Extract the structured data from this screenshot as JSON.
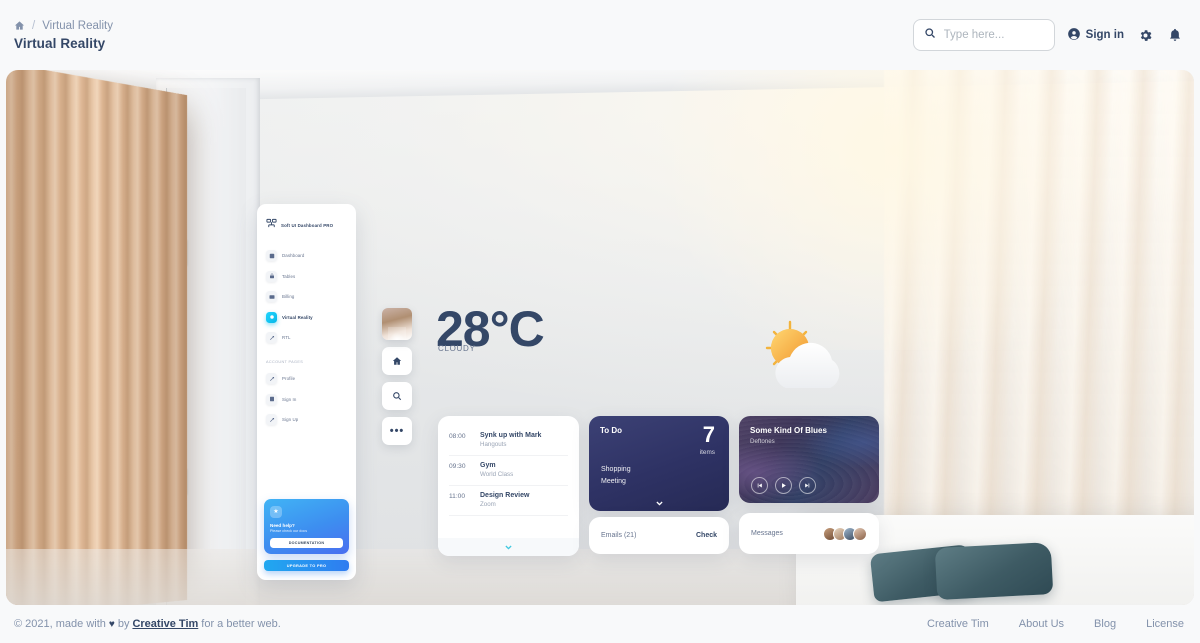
{
  "header": {
    "breadcrumb": {
      "home_icon": "home-icon",
      "separator": "/",
      "current": "Virtual Reality"
    },
    "page_title": "Virtual Reality",
    "search": {
      "placeholder": "Type here...",
      "value": "",
      "icon": "search-icon"
    },
    "sign_in": {
      "label": "Sign in",
      "icon": "account-circle-icon"
    },
    "settings_icon": "gear-icon",
    "notifications_icon": "bell-icon"
  },
  "vr_sidebar": {
    "brand": "Soft UI Dashboard PRO",
    "brand_icon": "soft-ui-logo-icon",
    "items": [
      {
        "label": "Dashboard",
        "icon": "dashboard-icon",
        "active": false
      },
      {
        "label": "Tables",
        "icon": "tables-icon",
        "active": false
      },
      {
        "label": "Billing",
        "icon": "billing-icon",
        "active": false
      },
      {
        "label": "Virtual Reality",
        "icon": "virtual-reality-icon",
        "active": true
      },
      {
        "label": "RTL",
        "icon": "rtl-icon",
        "active": false
      }
    ],
    "section_label": "ACCOUNT PAGES",
    "account_items": [
      {
        "label": "Profile",
        "icon": "profile-icon"
      },
      {
        "label": "Sign In",
        "icon": "sign-in-icon"
      },
      {
        "label": "Sign Up",
        "icon": "sign-up-icon"
      }
    ],
    "help_card": {
      "star_icon": "star-icon",
      "title": "Need help?",
      "subtitle": "Please check our docs",
      "documentation_label": "DOCUMENTATION"
    },
    "upgrade_label": "UPGRADE TO PRO"
  },
  "rail": {
    "avatar": "user-avatar",
    "home_icon": "home-icon",
    "search_icon": "search-icon",
    "more_icon": "more-horizontal-icon"
  },
  "weather": {
    "temperature": "28°C",
    "condition": "CLOUDY",
    "illustration": "sun-behind-cloud-icon"
  },
  "schedule": {
    "rows": [
      {
        "time": "08:00",
        "title": "Synk up with Mark",
        "subtitle": "Hangouts"
      },
      {
        "time": "09:30",
        "title": "Gym",
        "subtitle": "World Class"
      },
      {
        "time": "11:00",
        "title": "Design Review",
        "subtitle": "Zoom"
      }
    ],
    "expand_icon": "chevron-down-icon"
  },
  "todo": {
    "title": "To Do",
    "count": "7",
    "count_label": "items",
    "items": [
      "Shopping",
      "Meeting"
    ],
    "expand_icon": "chevron-down-icon"
  },
  "music": {
    "track": "Some Kind Of Blues",
    "artist": "Deftones",
    "controls": [
      {
        "name": "previous-track-button",
        "icon": "skip-previous-icon"
      },
      {
        "name": "play-button",
        "icon": "play-icon"
      },
      {
        "name": "next-track-button",
        "icon": "skip-next-icon"
      }
    ]
  },
  "emails": {
    "label": "Emails (21)",
    "action": "Check"
  },
  "messages": {
    "label": "Messages",
    "avatar_count": 4
  },
  "footer": {
    "copyright_prefix": "© 2021, made with",
    "heart": "♥",
    "by": "by",
    "author": "Creative Tim",
    "copyright_suffix": "for a better web.",
    "links": [
      "Creative Tim",
      "About Us",
      "Blog",
      "License"
    ]
  },
  "colors": {
    "accent": "#21d4fd",
    "title": "#344767",
    "muted": "#8392ab",
    "page_bg": "#f8f9fa"
  }
}
